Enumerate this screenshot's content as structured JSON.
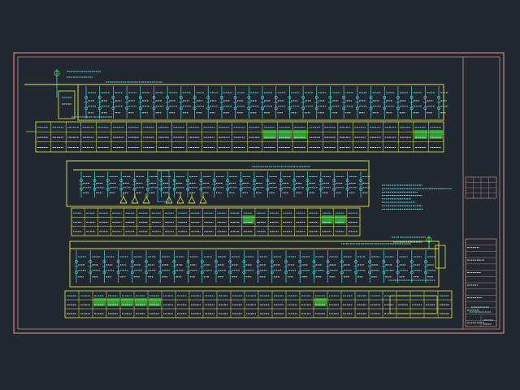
{
  "drawing": {
    "background": "#212830",
    "colors": {
      "frame": "#d98f8f",
      "panel": "#e8e84a",
      "device": "#4fd6e6",
      "highlight": "#39ff3c",
      "text_cyan": "#6fe6ee",
      "text_white": "#e6e6e6"
    },
    "panel_1": {
      "circuit_count": 27,
      "table_columns": 27,
      "table_rows": 3,
      "highlight_columns": [
        15,
        16,
        17,
        25,
        26
      ]
    },
    "panel_2": {
      "circuit_count": 22,
      "transformer_count": 7,
      "table_columns": 22,
      "table_rows": 3,
      "highlight_columns": [
        13,
        19,
        20
      ]
    },
    "panel_3": {
      "circuit_count": 26,
      "table_columns": 28,
      "table_rows": 3,
      "highlight_columns": [
        2,
        3,
        4,
        5,
        6,
        18
      ]
    },
    "notes_line_count": 8,
    "title_block_rows": 14
  }
}
